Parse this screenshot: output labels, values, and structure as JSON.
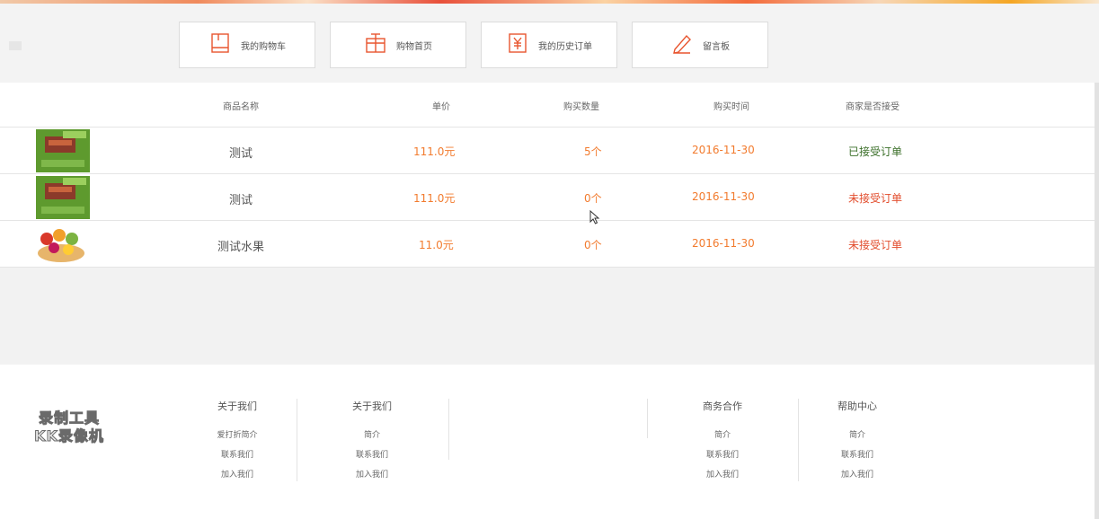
{
  "nav": [
    {
      "label": "我的购物车",
      "icon": "cart-icon"
    },
    {
      "label": "购物首页",
      "icon": "gift-icon"
    },
    {
      "label": "我的历史订单",
      "icon": "yuan-icon"
    },
    {
      "label": "留言板",
      "icon": "pencil-icon"
    }
  ],
  "table": {
    "headers": [
      "商品名称",
      "单价",
      "购买数量",
      "购买时间",
      "商家是否接受"
    ],
    "rows": [
      {
        "name": "测试",
        "price": "111.0元",
        "qty": "5个",
        "date": "2016-11-30",
        "status": "已接受订单",
        "status_kind": "accepted",
        "image": "gift-box-thumbnail"
      },
      {
        "name": "测试",
        "price": "111.0元",
        "qty": "0个",
        "date": "2016-11-30",
        "status": "未接受订单",
        "status_kind": "pending",
        "image": "gift-box-thumbnail"
      },
      {
        "name": "测试水果",
        "price": "11.0元",
        "qty": "0个",
        "date": "2016-11-30",
        "status": "未接受订单",
        "status_kind": "pending",
        "image": "fruit-basket-thumbnail"
      }
    ]
  },
  "colors": {
    "accent": "#f27b2e",
    "accepted": "#3a6f28",
    "pending": "#e24c2c",
    "icon": "#e8552f"
  },
  "footer": {
    "columns": [
      {
        "title": "关于我们",
        "links": [
          "爱打折简介",
          "联系我们",
          "加入我们"
        ]
      },
      {
        "title": "关于我们",
        "links": [
          "简介",
          "联系我们",
          "加入我们"
        ]
      },
      {
        "title": "商务合作",
        "links": [
          "简介",
          "联系我们",
          "加入我们"
        ]
      },
      {
        "title": "帮助中心",
        "links": [
          "简介",
          "联系我们",
          "加入我们"
        ]
      }
    ]
  },
  "watermark": {
    "line1": "录制工具",
    "line2": "KK录像机"
  }
}
